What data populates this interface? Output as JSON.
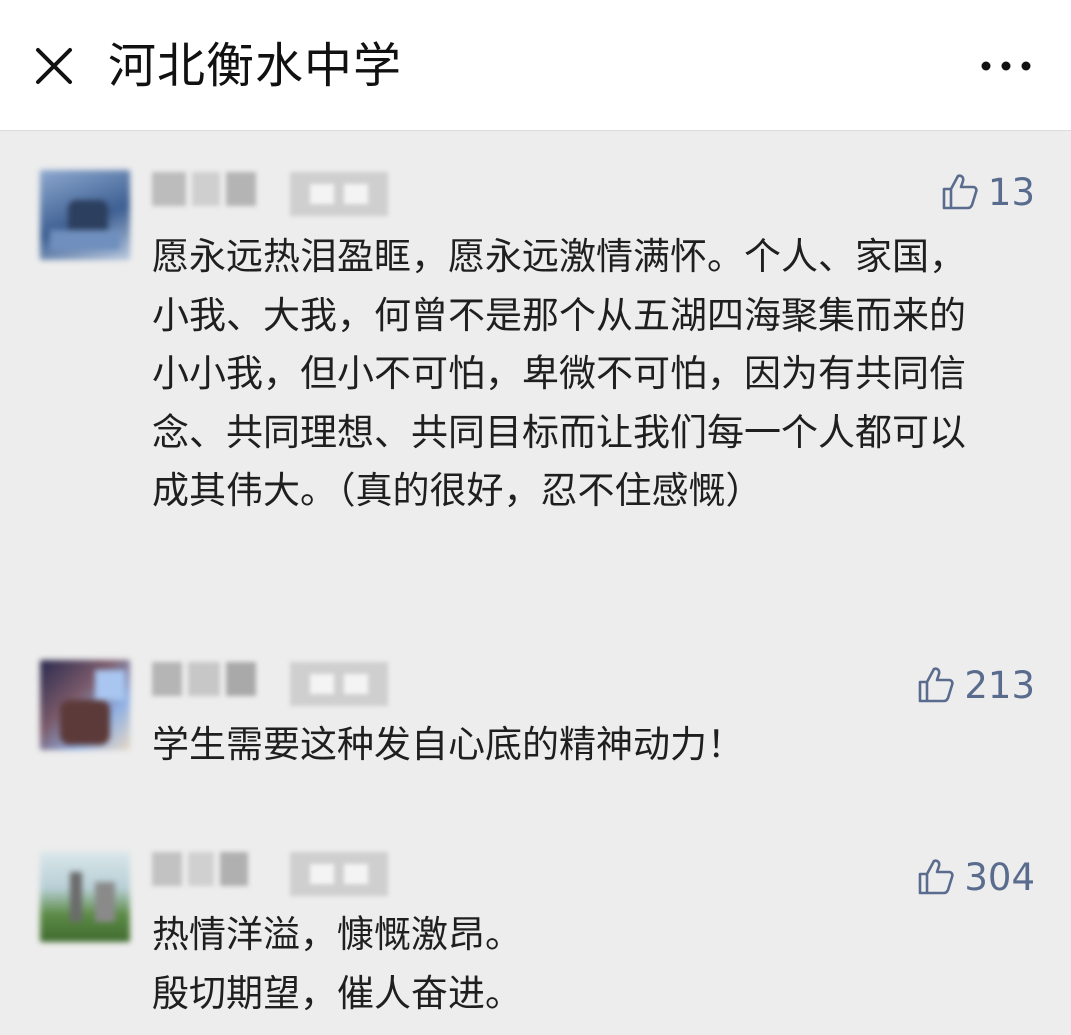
{
  "header": {
    "title": "河北衡水中学",
    "close_icon": "close-icon",
    "more_icon": "more-dots-icon"
  },
  "colors": {
    "header_bg": "#ffffff",
    "page_bg": "#ededed",
    "like_color": "#5a6c8e",
    "text_color": "#1f1f1f"
  },
  "comments": [
    {
      "likes": "13",
      "text": "愿永远热泪盈眶，愿永远激情满怀。个人、家国，小我、大我，何曾不是那个从五湖四海聚集而来的小小我，但小不可怕，卑微不可怕，因为有共同信念、共同理想、共同目标而让我们每一个人都可以成其伟大。（真的很好，忍不住感慨）"
    },
    {
      "likes": "213",
      "text": "学生需要这种发自心底的精神动力！"
    },
    {
      "likes": "304",
      "text": "热情洋溢，慷慨激昂。\n殷切期望，催人奋进。"
    }
  ]
}
